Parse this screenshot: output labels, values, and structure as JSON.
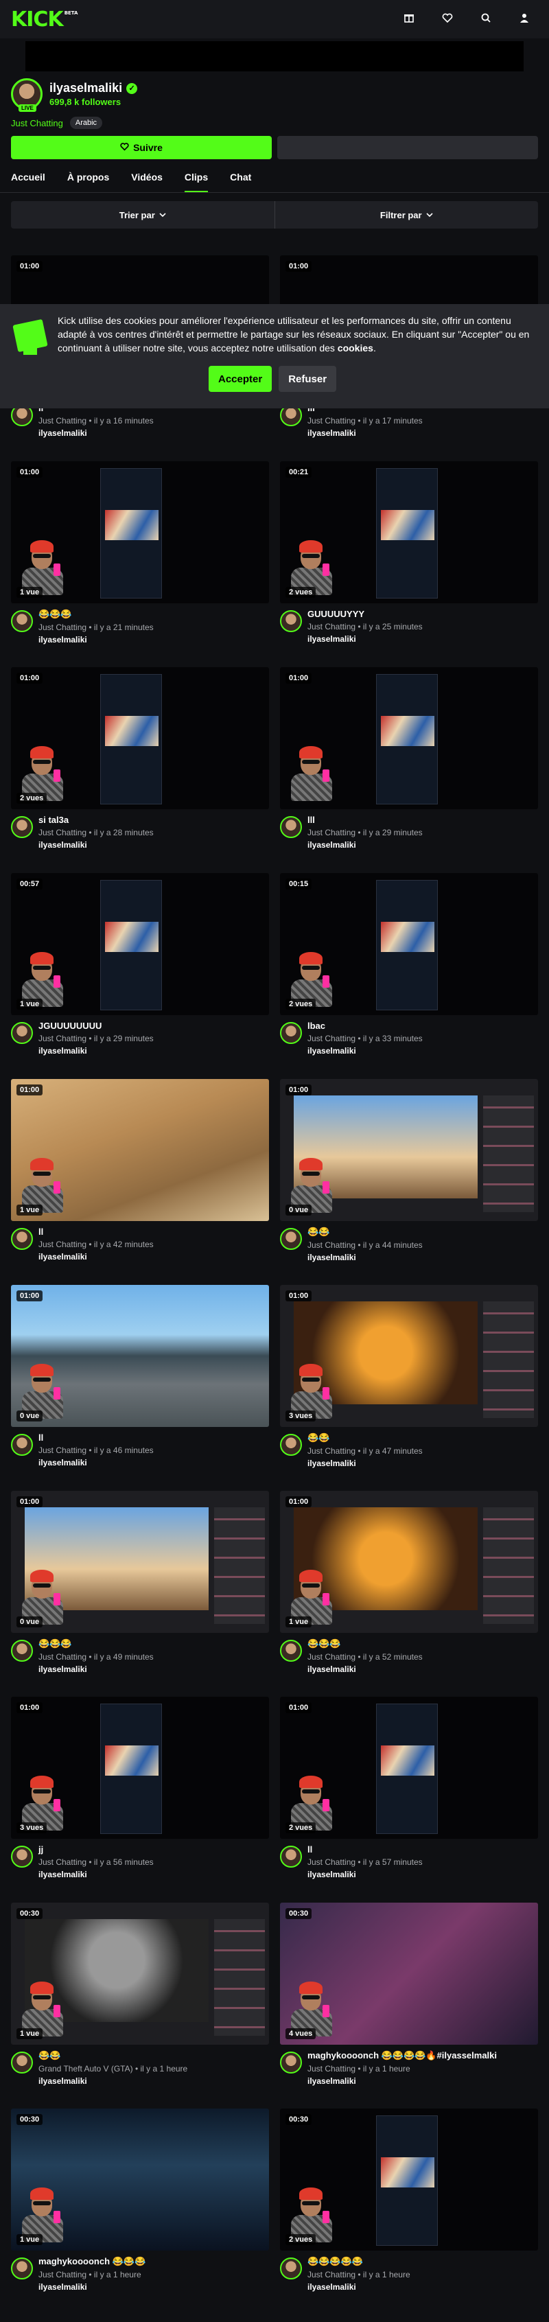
{
  "header": {
    "logo": "KICK",
    "logo_badge": "BETA",
    "icons": [
      "gift-icon",
      "heart-icon",
      "search-icon",
      "user-icon"
    ]
  },
  "channel": {
    "name": "ilyaselmaliki",
    "live_badge": "LIVE",
    "followers": "699,8 k followers",
    "category": "Just Chatting",
    "tag": "Arabic",
    "follow_label": "Suivre"
  },
  "tabs": [
    "Accueil",
    "À propos",
    "Vidéos",
    "Clips",
    "Chat"
  ],
  "active_tab": "Clips",
  "filters": {
    "sort": "Trier par",
    "filter": "Filtrer par"
  },
  "cookie": {
    "text_before": "Kick utilise des cookies pour améliorer l'expérience utilisateur et les performances du site, offrir un contenu adapté à vos centres d'intérêt et permettre le partage sur les réseaux sociaux. En cliquant sur \"Accepter\" ou en continuant à utiliser notre site, vous acceptez notre utilisation des ",
    "text_bold": "cookies",
    "text_after": ".",
    "accept": "Accepter",
    "refuse": "Refuser"
  },
  "clips": [
    {
      "duration": "01:00",
      "views": "",
      "title": "ll",
      "category": "Just Chatting",
      "time": "il y a 16 minutes",
      "channel": "ilyaselmaliki",
      "style": "dark"
    },
    {
      "duration": "01:00",
      "views": "",
      "title": "lll",
      "category": "Just Chatting",
      "time": "il y a 17 minutes",
      "channel": "ilyaselmaliki",
      "style": "dark"
    },
    {
      "duration": "01:00",
      "views": "1 vue",
      "title": "😂😂😂",
      "category": "Just Chatting",
      "time": "il y a 21 minutes",
      "channel": "ilyaselmaliki",
      "style": "screen"
    },
    {
      "duration": "00:21",
      "views": "2 vues",
      "title": "GUUUUUYYY",
      "category": "Just Chatting",
      "time": "il y a 25 minutes",
      "channel": "ilyaselmaliki",
      "style": "screen"
    },
    {
      "duration": "01:00",
      "views": "2 vues",
      "title": "si tal3a",
      "category": "Just Chatting",
      "time": "il y a 28 minutes",
      "channel": "ilyaselmaliki",
      "style": "screen"
    },
    {
      "duration": "01:00",
      "views": "",
      "title": "lll",
      "category": "Just Chatting",
      "time": "il y a 29 minutes",
      "channel": "ilyaselmaliki",
      "style": "screen"
    },
    {
      "duration": "00:57",
      "views": "1 vue",
      "title": "JGUUUUUUUU",
      "category": "Just Chatting",
      "time": "il y a 29 minutes",
      "channel": "ilyaselmaliki",
      "style": "screen"
    },
    {
      "duration": "00:15",
      "views": "2 vues",
      "title": "lbac",
      "category": "Just Chatting",
      "time": "il y a 33 minutes",
      "channel": "ilyaselmaliki",
      "style": "screen"
    },
    {
      "duration": "01:00",
      "views": "1 vue",
      "title": "ll",
      "category": "Just Chatting",
      "time": "il y a 42 minutes",
      "channel": "ilyaselmaliki",
      "style": "desert"
    },
    {
      "duration": "01:00",
      "views": "0 vue",
      "title": "😂😂",
      "category": "Just Chatting",
      "time": "il y a 44 minutes",
      "channel": "ilyaselmaliki",
      "style": "browser"
    },
    {
      "duration": "01:00",
      "views": "0 vue",
      "title": "ll",
      "category": "Just Chatting",
      "time": "il y a 46 minutes",
      "channel": "ilyaselmaliki",
      "style": "gta"
    },
    {
      "duration": "01:00",
      "views": "3 vues",
      "title": "😂😂",
      "category": "Just Chatting",
      "time": "il y a 47 minutes",
      "channel": "ilyaselmaliki",
      "style": "browser"
    },
    {
      "duration": "01:00",
      "views": "0 vue",
      "title": "😂😂😂",
      "category": "Just Chatting",
      "time": "il y a 49 minutes",
      "channel": "ilyaselmaliki",
      "style": "browser"
    },
    {
      "duration": "01:00",
      "views": "1 vue",
      "title": "😂😂😂",
      "category": "Just Chatting",
      "time": "il y a 52 minutes",
      "channel": "ilyaselmaliki",
      "style": "browser"
    },
    {
      "duration": "01:00",
      "views": "3 vues",
      "title": "jj",
      "category": "Just Chatting",
      "time": "il y a 56 minutes",
      "channel": "ilyaselmaliki",
      "style": "screen"
    },
    {
      "duration": "01:00",
      "views": "2 vues",
      "title": "ll",
      "category": "Just Chatting",
      "time": "il y a 57 minutes",
      "channel": "ilyaselmaliki",
      "style": "screen"
    },
    {
      "duration": "00:30",
      "views": "1 vue",
      "title": "😂😂",
      "category": "Grand Theft Auto V (GTA)",
      "time": "il y a 1 heure",
      "channel": "ilyaselmaliki",
      "style": "browser"
    },
    {
      "duration": "00:30",
      "views": "4 vues",
      "title": "maghykoooonch 😂😂😂😂🔥#ilyasselmalki",
      "category": "Just Chatting",
      "time": "il y a 1 heure",
      "channel": "ilyaselmaliki",
      "style": "shooter"
    },
    {
      "duration": "00:30",
      "views": "1 vue",
      "title": "maghykoooonch 😂😂😂",
      "category": "Just Chatting",
      "time": "il y a 1 heure",
      "channel": "ilyaselmaliki",
      "style": "night"
    },
    {
      "duration": "00:30",
      "views": "2 vues",
      "title": "😂😂😂😂😂",
      "category": "Just Chatting",
      "time": "il y a 1 heure",
      "channel": "ilyaselmaliki",
      "style": "screen"
    }
  ]
}
